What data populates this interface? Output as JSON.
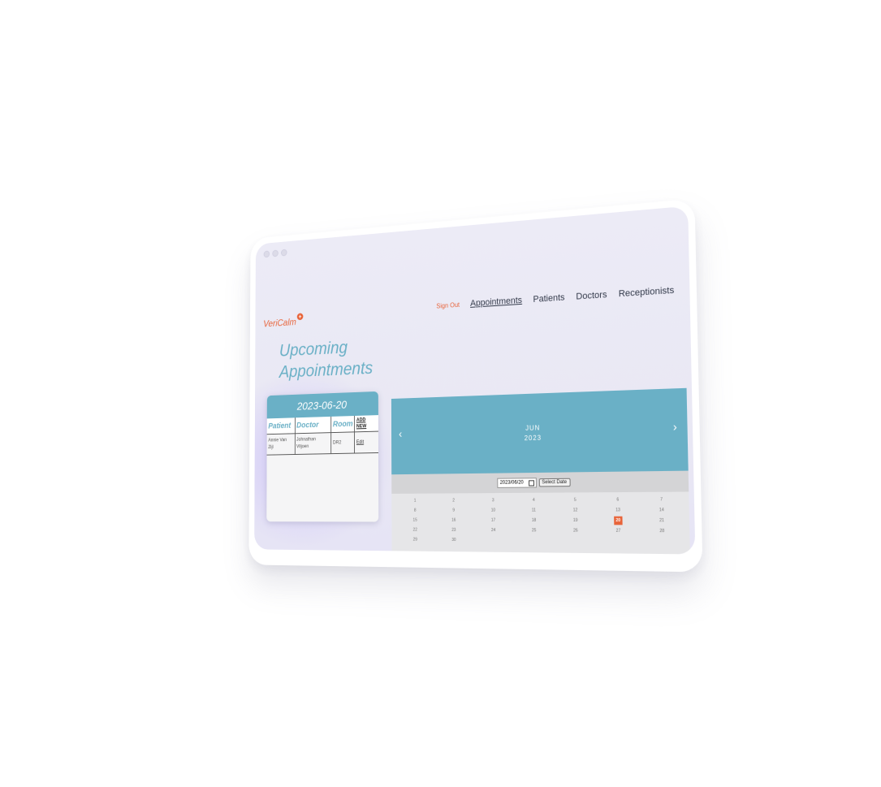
{
  "app": {
    "brand": "VeriCalm",
    "brand_icon": "plus-circle-icon"
  },
  "nav": {
    "sign_out": "Sign Out",
    "items": [
      "Appointments",
      "Patients",
      "Doctors",
      "Receptionists"
    ],
    "active": "Appointments"
  },
  "page": {
    "title_line1": "Upcoming",
    "title_line2": "Appointments"
  },
  "appointments": {
    "date": "2023-06-20",
    "columns": [
      "Patient",
      "Doctor",
      "Room"
    ],
    "add_new": "ADD NEW",
    "rows": [
      {
        "patient": "Annie Van Zijl",
        "doctor": "Johnathan Viljoen",
        "room": "DR2",
        "action": "Edit"
      }
    ]
  },
  "calendar": {
    "month": "JUN",
    "year": "2023",
    "prev_icon": "chevron-left-icon",
    "next_icon": "chevron-right-icon",
    "date_input_value": "2023/06/20",
    "select_label": "Select Date",
    "selected_day": 20,
    "weeks": [
      [
        "1",
        "2",
        "3",
        "4",
        "5",
        "6",
        "7"
      ],
      [
        "8",
        "9",
        "10",
        "11",
        "12",
        "13",
        "14"
      ],
      [
        "15",
        "16",
        "17",
        "18",
        "19",
        "20",
        "21"
      ],
      [
        "22",
        "23",
        "24",
        "25",
        "26",
        "27",
        "28"
      ],
      [
        "29",
        "30",
        "",
        "",
        "",
        "",
        ""
      ]
    ]
  },
  "colors": {
    "accent": "#6ab0c6",
    "brand": "#e8643a",
    "background": "#ecebf6"
  }
}
